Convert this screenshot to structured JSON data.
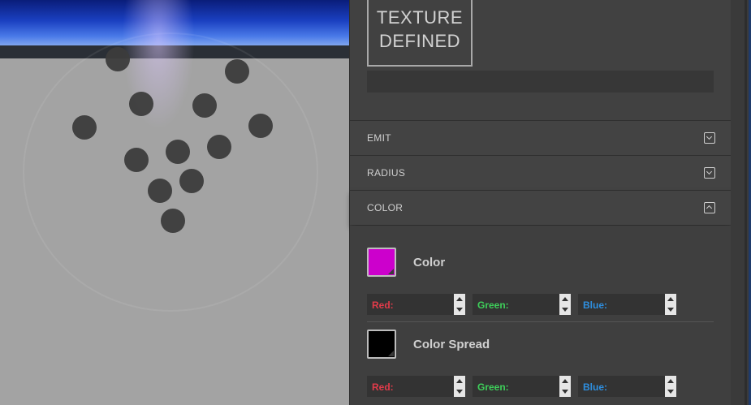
{
  "texture": {
    "line1": "TEXTURE",
    "line2": "DEFINED"
  },
  "sections": [
    {
      "label": "EMIT",
      "expanded": false
    },
    {
      "label": "RADIUS",
      "expanded": false
    },
    {
      "label": "COLOR",
      "expanded": true
    }
  ],
  "color": {
    "primary": {
      "title": "Color",
      "swatch": "#cc00cc",
      "channels": [
        "Red:",
        "Green:",
        "Blue:"
      ]
    },
    "spread": {
      "title": "Color Spread",
      "swatch": "#000000",
      "channels": [
        "Red:",
        "Green:",
        "Blue:"
      ]
    }
  },
  "channel_colors": {
    "red": "#e23b4a",
    "green": "#3ecf5a",
    "blue": "#2e8fe0"
  },
  "particle_count": 13
}
